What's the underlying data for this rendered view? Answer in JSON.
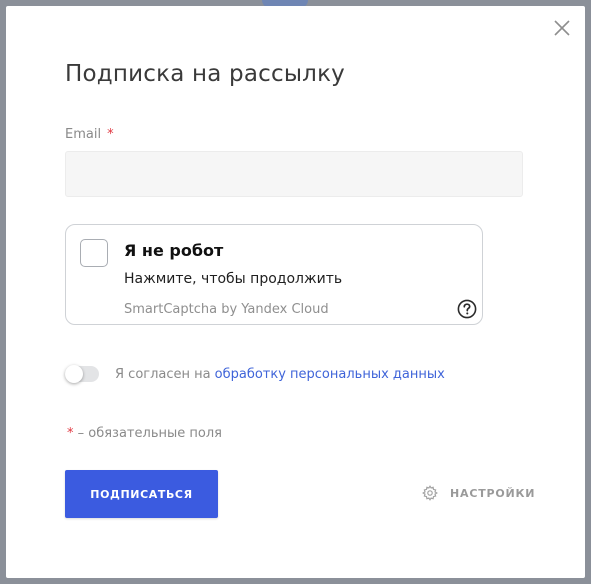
{
  "modal": {
    "title": "Подписка на рассылку"
  },
  "email": {
    "label": "Email",
    "required_mark": "*",
    "value": "",
    "placeholder": ""
  },
  "captcha": {
    "title": "Я не робот",
    "subtitle": "Нажмите, чтобы продолжить",
    "brand": "SmartCaptcha by Yandex Cloud",
    "help_icon": "question-circle-icon"
  },
  "consent": {
    "text": "Я согласен на",
    "link_text": "обработку персональных данных",
    "toggle_on": false
  },
  "required_note": {
    "star": "*",
    "text": " – обязательные поля"
  },
  "actions": {
    "submit_label": "ПОДПИСАТЬСЯ",
    "settings_label": "НАСТРОЙКИ",
    "settings_icon": "gear-icon"
  },
  "colors": {
    "accent": "#3b5be0",
    "link": "#3f64d9",
    "required": "#e0353f"
  }
}
